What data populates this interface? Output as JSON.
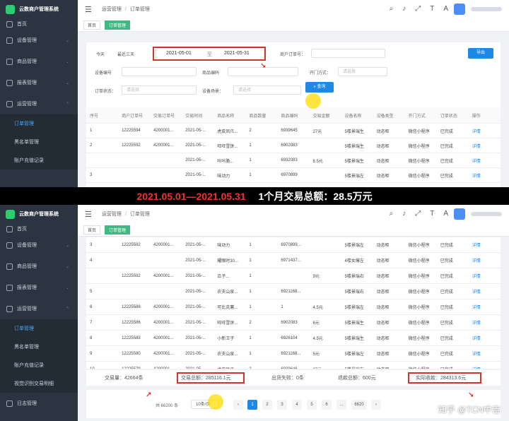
{
  "sidebar": {
    "app_title": "云数商户管理系统",
    "menu": [
      {
        "label": "首页",
        "icon": "home-icon"
      },
      {
        "label": "设备管理",
        "icon": "device-icon"
      },
      {
        "label": "商品管理",
        "icon": "goods-icon"
      },
      {
        "label": "报表管理",
        "icon": "report-icon"
      },
      {
        "label": "运营管理",
        "icon": "gear-icon"
      }
    ],
    "sub_menu": [
      "订单管理",
      "黑名单管理",
      "账户充值记录",
      "视觉识别交易明细"
    ],
    "bottom_item": "日志管理"
  },
  "header": {
    "breadcrumbs": [
      "运营管理",
      "订单管理"
    ]
  },
  "tabs": [
    "首页",
    "订单管理"
  ],
  "filters": {
    "today": "今天",
    "last3": "最近三天",
    "date_start": "2021-05-01",
    "date_to": "至",
    "date_end": "2021-05-31",
    "merchant_order_label": "商户订单号：",
    "device_no_label": "设备编号",
    "goods_code_label": "商品编码",
    "open_mode_label": "开门方式：",
    "open_mode_placeholder": "请选择",
    "order_status_label": "订单状态：",
    "order_status_placeholder": "请选择",
    "device_scene_label": "设备场景：",
    "device_scene_placeholder": "请选择",
    "query_button": "查询",
    "export_button": "导出"
  },
  "table": {
    "columns": [
      "序号",
      "商户订单号",
      "交易订单号",
      "交易时间",
      "商品名称",
      "商品数量",
      "商品编码",
      "交易金额",
      "设备名称",
      "设备类型",
      "开门方式",
      "订单状态",
      "操作"
    ],
    "top_rows": [
      [
        "1",
        "12225594",
        "4200001...",
        "2021-05-...",
        "虎皮凤爪...",
        "2",
        "6939645",
        "27元",
        "5楼景瑞生",
        "动态柜",
        "微信小程序",
        "已完成",
        "详情"
      ],
      [
        "2",
        "12225592",
        "4200001...",
        "2021-05-...",
        "旺旺雪饼...",
        "1",
        "6902083",
        "",
        "5楼景瑞生",
        "动态柜",
        "微信小程序",
        "已完成",
        "详情"
      ],
      [
        "",
        "",
        "",
        "2021-05-...",
        "咔咔脆...",
        "1",
        "6932083",
        "8.5元",
        "5楼景瑞生",
        "动态柜",
        "微信小程序",
        "已完成",
        "详情"
      ],
      [
        "3",
        "",
        "",
        "2021-05-...",
        "味动力",
        "1",
        "6970899",
        "",
        "5楼景瑞左",
        "动态柜",
        "微信小程序",
        "已完成",
        "详情"
      ],
      [
        "4",
        "",
        "",
        "2021-05-...",
        "",
        "1",
        "6971437...",
        "",
        "4楼女爆左",
        "动态柜",
        "微信小程序",
        "已完成",
        "详情"
      ]
    ],
    "bottom_rows": [
      [
        "3",
        "12225592",
        "4200001...",
        "2021-05-...",
        "味动力",
        "1",
        "6970899...",
        "",
        "5楼景瑞左",
        "动态柜",
        "微信小程序",
        "已完成",
        "详情"
      ],
      [
        "4",
        "",
        "",
        "2021-05-...",
        "耀眼时30...",
        "1",
        "6971437...",
        "",
        "4楼女爆左",
        "动态柜",
        "微信小程序",
        "已完成",
        "详情"
      ],
      [
        "",
        "12225592",
        "4200001...",
        "2021-05-...",
        "瓜子...",
        "1",
        "",
        "9元",
        "5楼景瑞右",
        "动态柜",
        "微信小程序",
        "已完成",
        "详情"
      ],
      [
        "5",
        "",
        "",
        "2021-05-...",
        "农夫山泉...",
        "1",
        "6921168...",
        "",
        "5楼景瑞右",
        "动态柜",
        "微信小程序",
        "已完成",
        "详情"
      ],
      [
        "6",
        "12225588",
        "4200001...",
        "2021-05-...",
        "可比克薯...",
        "1",
        "1",
        "4.5元",
        "5楼景瑞左",
        "动态柜",
        "微信小程序",
        "已完成",
        "详情"
      ],
      [
        "7",
        "12225586",
        "4200001...",
        "2021-05-...",
        "旺旺雪饼...",
        "2",
        "6902083",
        "6元",
        "5楼景瑞生",
        "动态柜",
        "微信小程序",
        "已完成",
        "详情"
      ],
      [
        "8",
        "12225583",
        "4200001...",
        "2021-05-...",
        "小新王子",
        "1",
        "6926104",
        "4.5元",
        "5楼景瑞生",
        "动态柜",
        "微信小程序",
        "已完成",
        "详情"
      ],
      [
        "9",
        "12225580",
        "4200001...",
        "2021-05-...",
        "农夫山泉...",
        "1",
        "6921168...",
        "5元",
        "5楼景瑞左",
        "动态柜",
        "微信小程序",
        "已完成",
        "详情"
      ],
      [
        "10",
        "12225579",
        "4200001...",
        "2021-05-...",
        "虎皮凤爪...",
        "2",
        "6939646",
        "27元",
        "5楼景瑞左",
        "动态柜",
        "微信小程序",
        "已完成",
        "详情"
      ]
    ]
  },
  "banner": {
    "period": "2021.05.01—2021.05.31",
    "total": "1个月交易总额：28.5万元"
  },
  "summary": {
    "count": "交易量：42664条",
    "total": "交易总额：285116.1元",
    "failed": "出货失败：0条",
    "refund": "退款总额：600元",
    "actual": "实际收款：284313.6元"
  },
  "pager": {
    "total": "共 66200 条",
    "page_size": "10条/页",
    "prev": "‹",
    "pages": [
      "1",
      "2",
      "3",
      "4",
      "5",
      "6",
      "...",
      "6620"
    ],
    "next": "›"
  },
  "watermark": "知乎 @TCN中吉",
  "colors": {
    "accent": "#1e88e5",
    "highlight": "#d0342c",
    "tab_active": "#42b983",
    "sidebar": "#2b3440"
  }
}
